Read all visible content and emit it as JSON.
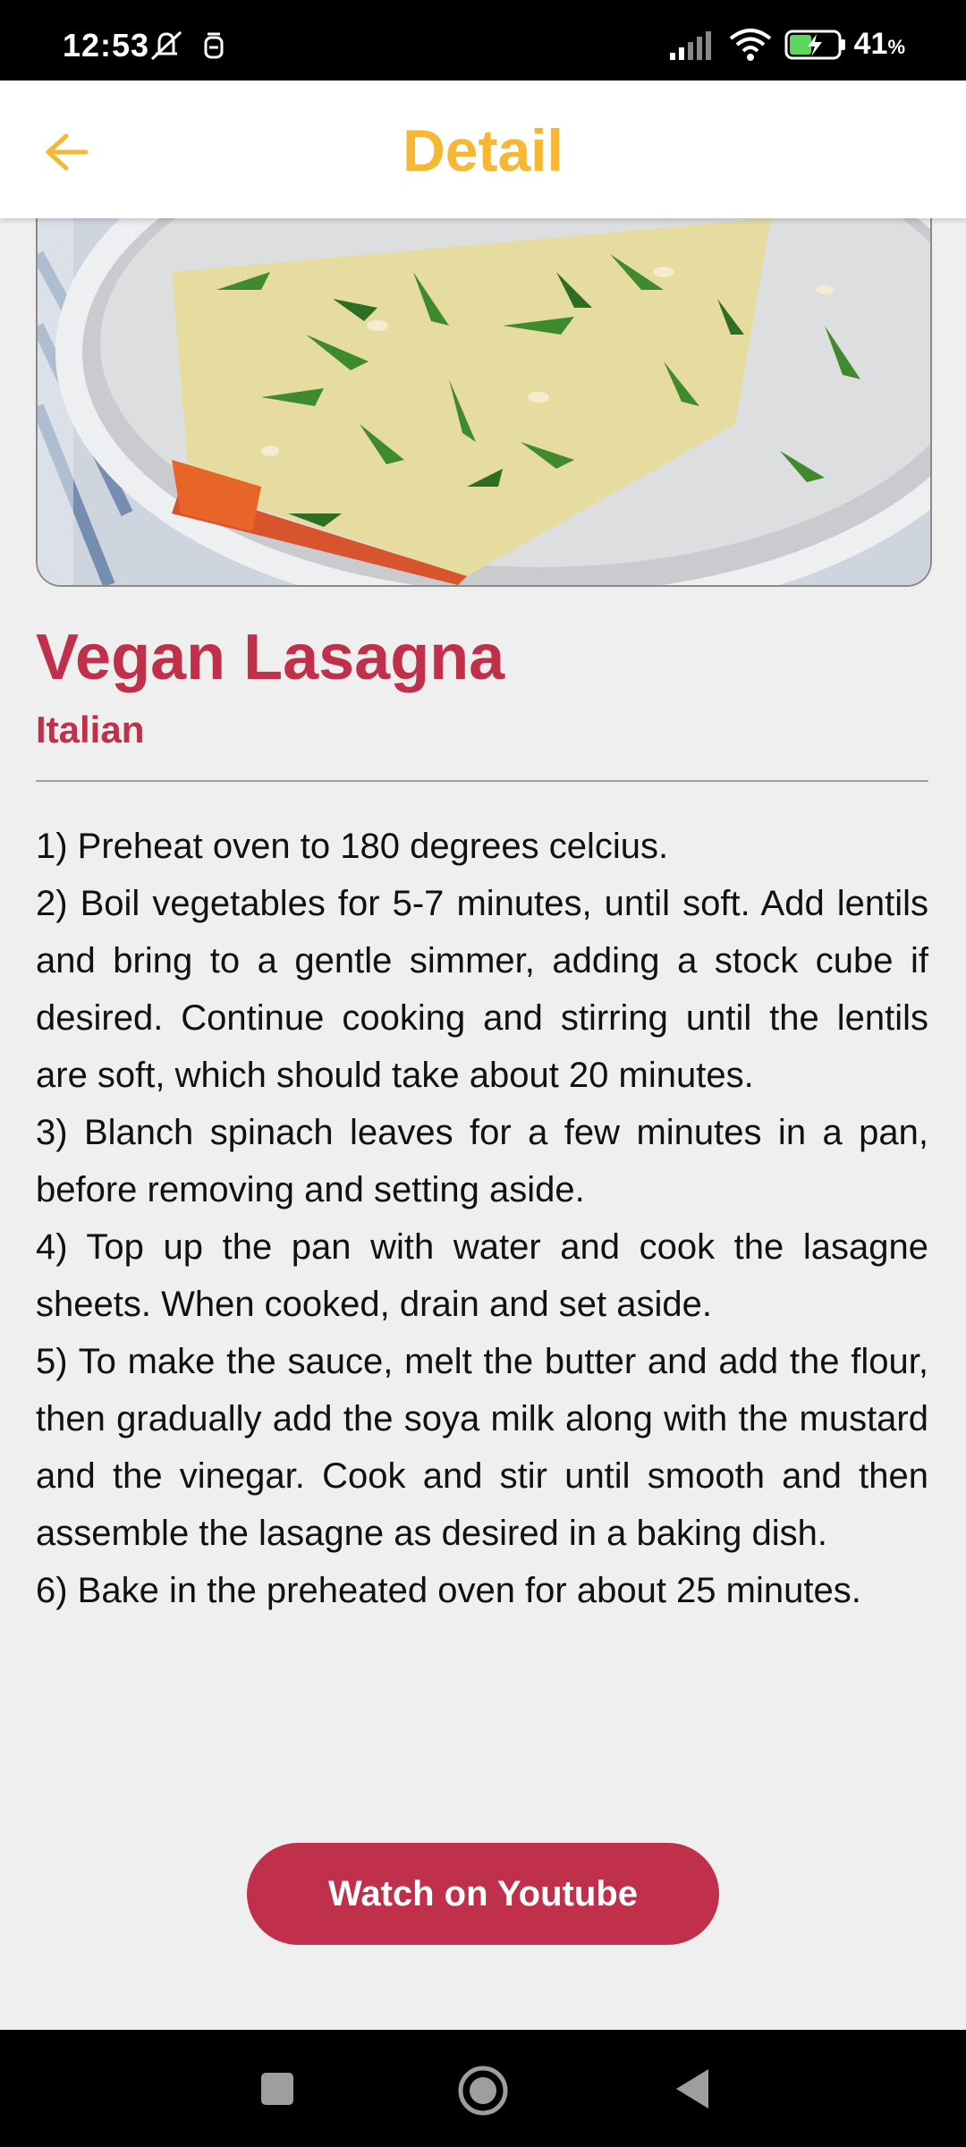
{
  "status_bar": {
    "time": "12:53",
    "battery_percent": "41",
    "battery_unit": "%",
    "icons": [
      "mute-icon",
      "alarm-icon",
      "signal-icon",
      "wifi-icon",
      "battery-charging-icon"
    ]
  },
  "app_bar": {
    "title": "Detail",
    "back_icon": "arrow-back-icon",
    "accent_color": "#f7b733"
  },
  "recipe": {
    "name": "Vegan Lasagna",
    "area": "Italian",
    "name_color": "#c0304a",
    "instructions": [
      "1) Preheat oven to 180 degrees celcius.",
      "2) Boil vegetables for 5-7 minutes, until soft. Add lentils and bring to a gentle simmer, adding a stock cube if desired. Continue cooking and stirring until the lentils are soft, which should take about 20 minutes.",
      "3) Blanch spinach leaves for a few minutes in a pan, before removing and setting aside.",
      "4) Top up the pan with water and cook the lasagne sheets. When cooked, drain and set aside.",
      "5) To make the sauce, melt the butter and add the flour, then gradually add the soya milk along with the mustard and the vinegar. Cook and stir until smooth and then assemble the lasagne as desired in a baking dish.",
      "6) Bake in the preheated oven for about 25 minutes."
    ]
  },
  "actions": {
    "youtube_label": "Watch on Youtube"
  },
  "nav_bar": {
    "icons": [
      "recents-icon",
      "home-icon",
      "back-nav-icon"
    ]
  }
}
